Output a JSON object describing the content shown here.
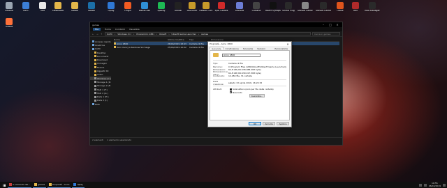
{
  "desktop": {
    "icons": [
      {
        "label": "Cestino",
        "color": "#9aa6b2"
      },
      {
        "label": "OoPC",
        "color": "#3c7fd6"
      },
      {
        "label": "Tolo",
        "color": "#e8e8e8"
      },
      {
        "label": "Download",
        "color": "#e3b64a"
      },
      {
        "label": "Steam",
        "color": "#e3b64a"
      },
      {
        "label": "Steam",
        "color": "#1b6fa8"
      },
      {
        "label": "Uplay",
        "color": "#2f78d6"
      },
      {
        "label": "Origin",
        "color": "#f05a22"
      },
      {
        "label": "Battle.net",
        "color": "#2f8fd6"
      },
      {
        "label": "Spotify",
        "color": "#1db954"
      },
      {
        "label": "Unreal",
        "color": "#222"
      },
      {
        "label": "Launcher",
        "color": "#c79a2a"
      },
      {
        "label": "Ubisoft Con.",
        "color": "#c79a2a"
      },
      {
        "label": "Epic Games",
        "color": "#d02a2a"
      },
      {
        "label": "Discord",
        "color": "#6c7dd6"
      },
      {
        "label": "Cortana",
        "color": "#444"
      },
      {
        "label": "Razer Synapse",
        "color": "#111"
      },
      {
        "label": "Shield Plug",
        "color": "#2a2a2a"
      },
      {
        "label": "Ubisoft Game Launcher",
        "color": "#888"
      },
      {
        "label": "Ubisoft Games",
        "color": "#2a2a2a"
      },
      {
        "label": "Office",
        "color": "#e0541c"
      },
      {
        "label": "Rev",
        "color": "#b02a2a"
      },
      {
        "label": "Mod Manager",
        "color": "#2a2a2a"
      },
      {
        "label": "Firefox",
        "color": "#ff7139"
      }
    ]
  },
  "explorer": {
    "title": "games",
    "ribbon_tabs": [
      "File",
      "Home",
      "Condividi",
      "Visualizza"
    ],
    "active_tab": "File",
    "breadcrumb": [
      "OoPC",
      "Windows (C:)",
      "Programmi (x86)",
      "Ubisoft",
      "Ubisoft Game Launcher",
      "games"
    ],
    "search_placeholder": "Cerca in games",
    "nav": [
      {
        "label": "Accesso rapido",
        "kind": "star",
        "level": 1
      },
      {
        "label": "OneDrive",
        "kind": "cloud",
        "level": 1
      },
      {
        "label": "OoPC",
        "kind": "pc",
        "level": 1
      },
      {
        "label": "Desktop",
        "kind": "folder",
        "level": 2
      },
      {
        "label": "Documenti",
        "kind": "folder",
        "level": 2
      },
      {
        "label": "Download",
        "kind": "folder",
        "level": 2
      },
      {
        "label": "Immagini",
        "kind": "folder",
        "level": 2
      },
      {
        "label": "Musica",
        "kind": "folder",
        "level": 2
      },
      {
        "label": "Oggetti 3D",
        "kind": "folder",
        "level": 2
      },
      {
        "label": "Video",
        "kind": "folder",
        "level": 2
      },
      {
        "label": "Windows (C:)",
        "kind": "drive",
        "level": 2,
        "selected": true
      },
      {
        "label": "Storage 1 (D:)",
        "kind": "drive",
        "level": 2
      },
      {
        "label": "Storage 2 (E:)",
        "kind": "drive",
        "level": 2
      },
      {
        "label": "SSD 1 (F:)",
        "kind": "drive",
        "level": 2
      },
      {
        "label": "SSD 2 (G:)",
        "kind": "drive",
        "level": 2
      },
      {
        "label": "Data 1 (H:)",
        "kind": "drive",
        "level": 2
      },
      {
        "label": "Data 2 (I:)",
        "kind": "drive",
        "level": 2
      },
      {
        "label": "Rete",
        "kind": "network",
        "level": 1
      }
    ],
    "columns": [
      "Nome",
      "Ultima modifica",
      "Tipo",
      "Dimensione"
    ],
    "rows": [
      {
        "name": "Anno 1800",
        "modified": "26/04/2019 18:43",
        "type": "Cartella di file",
        "size": "",
        "selected": true
      },
      {
        "name": "Tom Clancy's Rainbow Six Siege",
        "modified": "25/04/2019 16:02",
        "type": "Cartella di file",
        "size": ""
      }
    ],
    "status": [
      "2 elementi",
      "1 elemento selezionato"
    ]
  },
  "properties": {
    "title": "Proprietà - Anno 1800",
    "tabs": [
      "Generale",
      "Condivisione",
      "Sicurezza",
      "Versioni precedenti",
      "Personalizza"
    ],
    "active_tab": "Generale",
    "name": "Anno 1800",
    "type_label": "Tipo:",
    "type_value": "Cartella di file",
    "location_label": "Percorso:",
    "location_value": "C:\\Program Files (x86)\\Ubisoft\\Ubisoft Game Launcher\\games",
    "size_label": "Dimensioni:",
    "size_value": "64,8 GB (69.638.988.268 byte)",
    "disk_label": "Dimensioni su disco:",
    "disk_value": "64,8 GB (69.639.917.568 byte)",
    "contents_label": "Contenuto:",
    "contents_value": "12.484 file, 31 cartelle",
    "created_label": "Data creazione:",
    "created_value": "sabato 13 aprile 2019, 16:24:15",
    "attrs_label": "Attributi:",
    "readonly_label": "Sola lettura (solo per file della cartella)",
    "hidden_label": "Nascosto",
    "advanced_label": "Avanzate...",
    "ok": "OK",
    "cancel": "Annulla",
    "apply": "Applica"
  },
  "taskbar": {
    "items": [
      {
        "label": "a comando del...",
        "color": "#c43a3a"
      },
      {
        "label": "games",
        "color": "#e3b64a"
      },
      {
        "label": "Proprietà - Anno",
        "color": "#e3b64a"
      },
      {
        "label": "Uplay",
        "color": "#2f78d6"
      }
    ],
    "time": "10:55",
    "date": "26/04/2019"
  }
}
